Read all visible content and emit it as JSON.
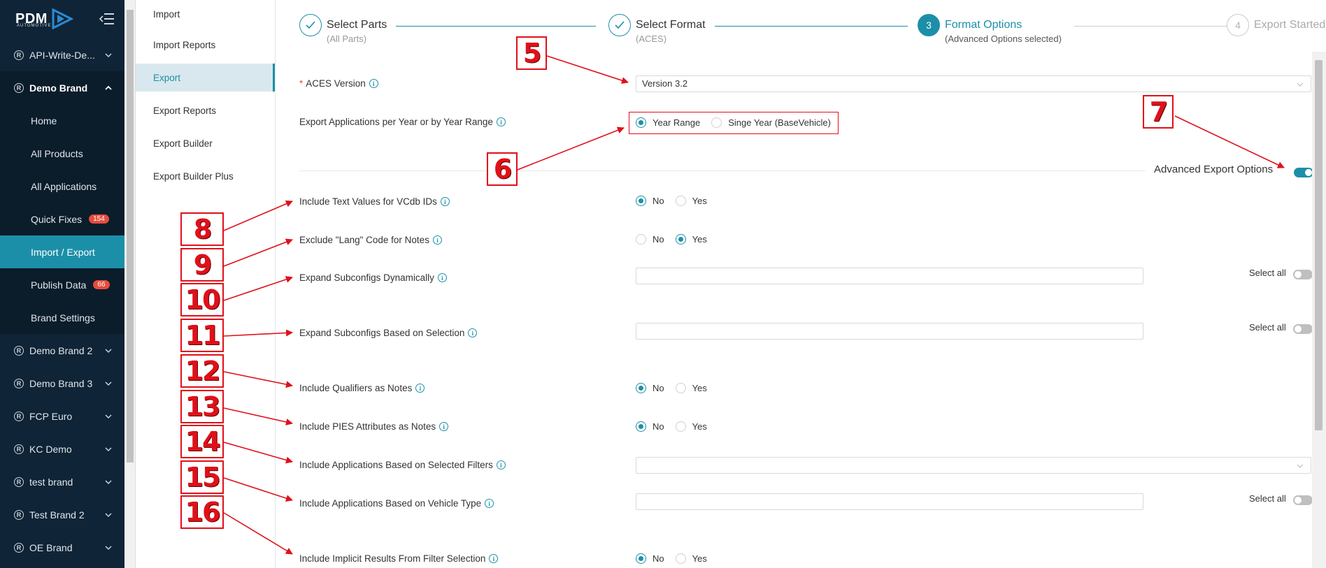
{
  "logo": {
    "text": "PDM",
    "subtext": "AUTOMOTIVE"
  },
  "sidebar": {
    "items": [
      {
        "label": "API-Write-De..."
      },
      {
        "label": "Demo Brand"
      },
      {
        "label": "Home"
      },
      {
        "label": "All Products"
      },
      {
        "label": "All Applications"
      },
      {
        "label": "Quick Fixes",
        "badge": "154"
      },
      {
        "label": "Import / Export"
      },
      {
        "label": "Publish Data",
        "badge": "66"
      },
      {
        "label": "Brand Settings"
      },
      {
        "label": "Demo Brand 2"
      },
      {
        "label": "Demo Brand 3"
      },
      {
        "label": "FCP Euro"
      },
      {
        "label": "KC Demo"
      },
      {
        "label": "test brand"
      },
      {
        "label": "Test Brand 2"
      },
      {
        "label": "OE Brand"
      }
    ],
    "reg_symbol": "R"
  },
  "subnav": {
    "items": [
      {
        "label": "Import"
      },
      {
        "label": "Import Reports"
      },
      {
        "label": "Export"
      },
      {
        "label": "Export Reports"
      },
      {
        "label": "Export Builder"
      },
      {
        "label": "Export Builder Plus"
      }
    ]
  },
  "steps": [
    {
      "title": "Select Parts",
      "desc": "(All Parts)",
      "number": ""
    },
    {
      "title": "Select Format",
      "desc": "(ACES)",
      "number": ""
    },
    {
      "title": "Format Options",
      "desc": "(Advanced Options selected)",
      "number": "3"
    },
    {
      "title": "Export Started",
      "desc": "",
      "number": "4"
    }
  ],
  "form": {
    "aces_version": {
      "required_mark": "*",
      "label": "ACES Version",
      "value": "Version 3.2"
    },
    "year_mode": {
      "label": "Export Applications per Year or by Year Range",
      "opt1": "Year Range",
      "opt2": "Singe Year (BaseVehicle)",
      "selected": "Year Range"
    },
    "advanced": {
      "label": "Advanced Export Options",
      "enabled": true
    },
    "text_values": {
      "label": "Include Text Values for VCdb IDs",
      "no": "No",
      "yes": "Yes",
      "selected": "No"
    },
    "lang_code": {
      "label": "Exclude \"Lang\" Code for Notes",
      "no": "No",
      "yes": "Yes",
      "selected": "Yes"
    },
    "subconfigs_dynamic": {
      "label": "Expand Subconfigs Dynamically",
      "select_all": "Select all",
      "value": ""
    },
    "subconfigs_selection": {
      "label": "Expand Subconfigs Based on Selection",
      "select_all": "Select all",
      "value": ""
    },
    "qualifiers": {
      "label": "Include Qualifiers as Notes",
      "no": "No",
      "yes": "Yes",
      "selected": "No"
    },
    "pies_attributes": {
      "label": "Include PIES Attributes as Notes",
      "no": "No",
      "yes": "Yes",
      "selected": "No"
    },
    "selected_filters": {
      "label": "Include Applications Based on Selected Filters",
      "value": ""
    },
    "vehicle_type": {
      "label": "Include Applications Based on Vehicle Type",
      "select_all": "Select all",
      "value": ""
    },
    "implicit_results": {
      "label": "Include Implicit Results From Filter Selection",
      "no": "No",
      "yes": "Yes",
      "selected": "No"
    }
  },
  "annotations": [
    "5",
    "6",
    "7",
    "8",
    "9",
    "10",
    "11",
    "12",
    "13",
    "14",
    "15",
    "16"
  ],
  "colors": {
    "sidebar_bg": "#0f2436",
    "accent": "#1c8fa8",
    "badge": "#e74c3c",
    "annotation": "#e0101a"
  }
}
